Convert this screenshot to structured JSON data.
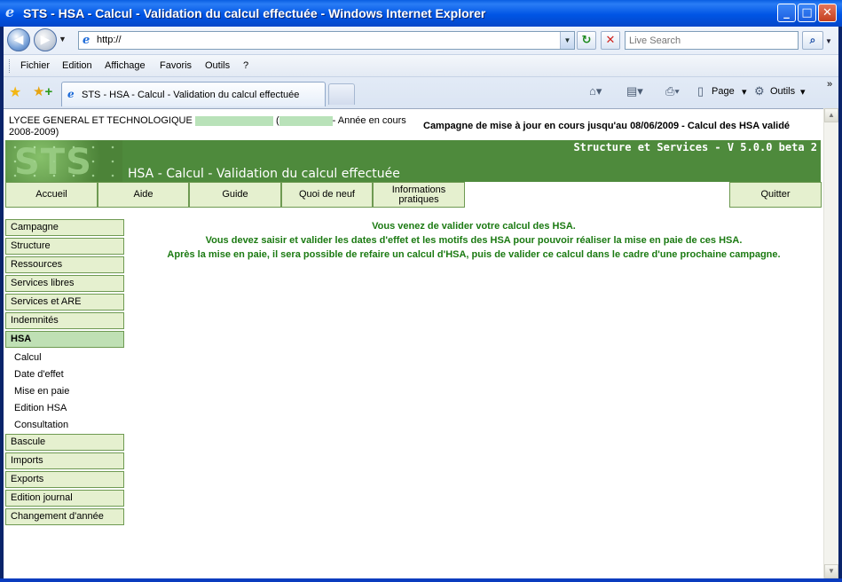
{
  "window": {
    "title": "STS - HSA - Calcul - Validation du calcul effectuée - Windows Internet Explorer",
    "min": "_",
    "max": "□",
    "close": "✕"
  },
  "nav": {
    "back": "◀",
    "forward": "▶",
    "address": "http://",
    "search_placeholder": "Live Search"
  },
  "menu": [
    "Fichier",
    "Edition",
    "Affichage",
    "Favoris",
    "Outils",
    "?"
  ],
  "tab": {
    "label": "STS - HSA - Calcul - Validation du calcul effectuée"
  },
  "commands": {
    "page": "Page",
    "tools": "Outils"
  },
  "header": {
    "school_prefix": "LYCEE GENERAL ET TECHNOLOGIQUE",
    "school_mid": "(",
    "school_suffix": "- Année en cours 2008-2009)",
    "campaign": "Campagne de mise à jour en cours jusqu'au 08/06/2009 - Calcul des HSA validé"
  },
  "banner": {
    "logo": "STS",
    "version": "Structure et Services - V 5.0.0 beta 2",
    "title": "HSA - Calcul - Validation du calcul effectuée"
  },
  "topnav": {
    "accueil": "Accueil",
    "aide": "Aide",
    "guide": "Guide",
    "quoi_de_neuf": "Quoi de neuf",
    "informations": "Informations pratiques",
    "quitter": "Quitter"
  },
  "sidebar": {
    "items": [
      "Campagne",
      "Structure",
      "Ressources",
      "Services libres",
      "Services et ARE",
      "Indemnités"
    ],
    "active": "HSA",
    "subitems": [
      "Calcul",
      "Date d'effet",
      "Mise en paie",
      "Edition HSA",
      "Consultation"
    ],
    "items_after": [
      "Bascule",
      "Imports",
      "Exports",
      "Edition journal",
      "Changement d'année"
    ]
  },
  "message": {
    "line1": "Vous venez de valider votre calcul des HSA.",
    "line2": "Vous devez saisir et valider les dates d'effet et les motifs des HSA pour pouvoir réaliser la mise en paie de ces HSA.",
    "line3": "Après la mise en paie, il sera possible de refaire un calcul d'HSA, puis de valider ce calcul dans le cadre d'une prochaine campagne."
  },
  "colors": {
    "banner": "#4e8a3c",
    "nav_bg": "#e5f0cf",
    "message": "#1b7a12"
  }
}
